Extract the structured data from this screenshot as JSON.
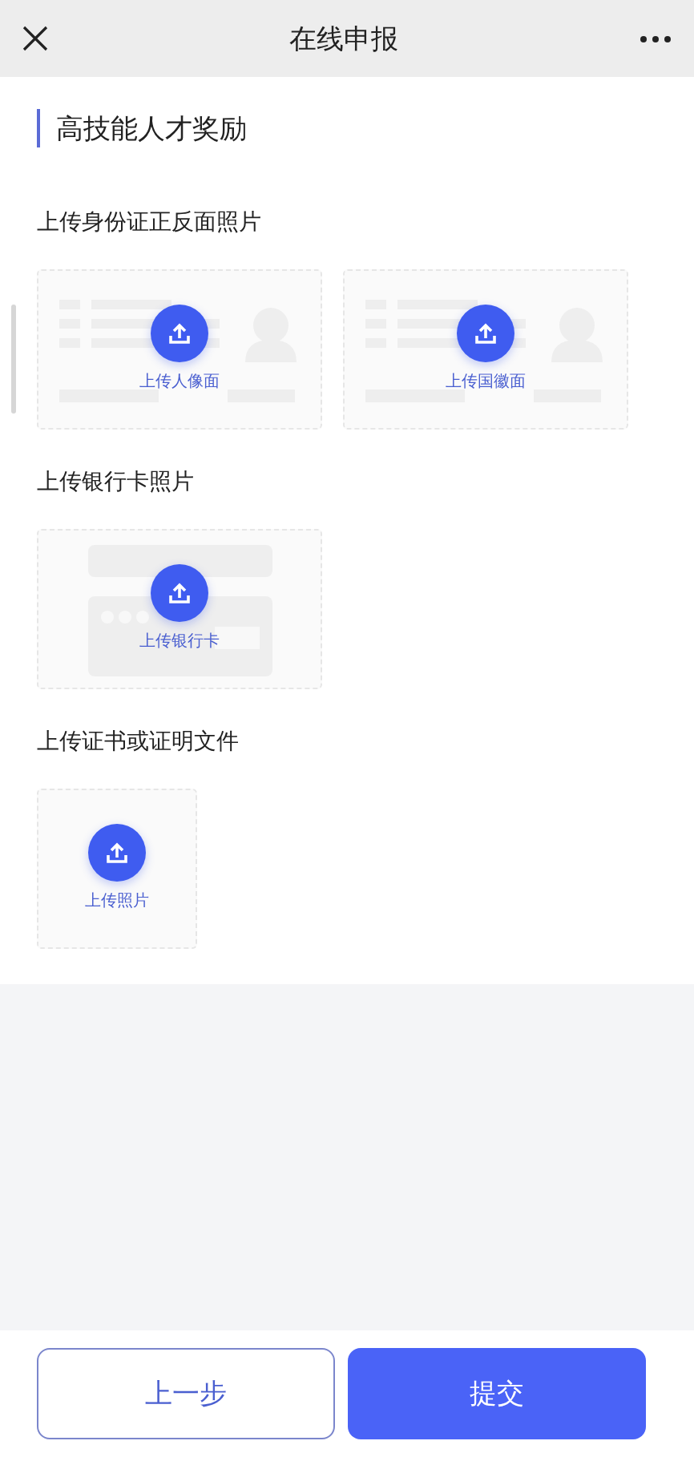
{
  "header": {
    "title": "在线申报"
  },
  "section_title": "高技能人才奖励",
  "groups": [
    {
      "label": "上传身份证正反面照片",
      "tiles": [
        {
          "kind": "id",
          "label": "上传人像面"
        },
        {
          "kind": "id",
          "label": "上传国徽面"
        }
      ]
    },
    {
      "label": "上传银行卡照片",
      "tiles": [
        {
          "kind": "card",
          "label": "上传银行卡"
        }
      ]
    },
    {
      "label": "上传证书或证明文件",
      "tiles": [
        {
          "kind": "plain",
          "label": "上传照片"
        }
      ]
    }
  ],
  "footer": {
    "back": "上一步",
    "submit": "提交"
  }
}
